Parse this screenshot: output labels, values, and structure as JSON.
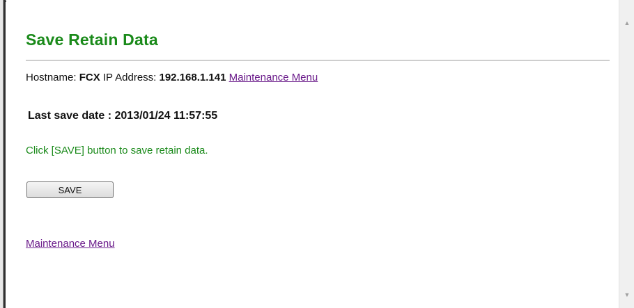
{
  "page": {
    "title": "Save Retain Data"
  },
  "host_info": {
    "hostname_label": "Hostname:",
    "hostname": "FCX",
    "ip_label": "IP Address:",
    "ip": "192.168.1.141",
    "maintenance_link": "Maintenance Menu"
  },
  "last_save": {
    "text": "Last save date : 2013/01/24 11:57:55"
  },
  "instruction": "Click [SAVE] button to save retain data.",
  "save_button": {
    "label": "SAVE"
  },
  "footer": {
    "maintenance_link": "Maintenance Menu"
  },
  "colors": {
    "title_green": "#1a8a1a",
    "link_purple": "#6a1a8a"
  },
  "icons": {
    "scroll_up": "scroll-up-arrow-icon",
    "scroll_down": "scroll-down-arrow-icon"
  }
}
